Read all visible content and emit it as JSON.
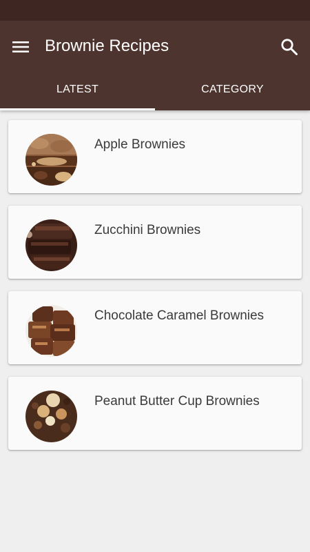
{
  "header": {
    "title": "Brownie Recipes",
    "menu_icon": "hamburger-menu-icon",
    "search_icon": "search-icon"
  },
  "tabs": [
    {
      "label": "LATEST",
      "active": true
    },
    {
      "label": "CATEGORY",
      "active": false
    }
  ],
  "recipes": [
    {
      "title": "Apple Brownies",
      "image": "apple-brownies-photo"
    },
    {
      "title": "Zucchini Brownies",
      "image": "zucchini-brownies-photo"
    },
    {
      "title": "Chocolate Caramel Brownies",
      "image": "chocolate-caramel-brownies-photo"
    },
    {
      "title": "Peanut Butter Cup Brownies",
      "image": "peanut-butter-cup-brownies-photo"
    }
  ],
  "colors": {
    "status_bar": "#3e2723",
    "app_bar": "#4e342e",
    "background": "#efefef",
    "card": "#fafafa"
  }
}
